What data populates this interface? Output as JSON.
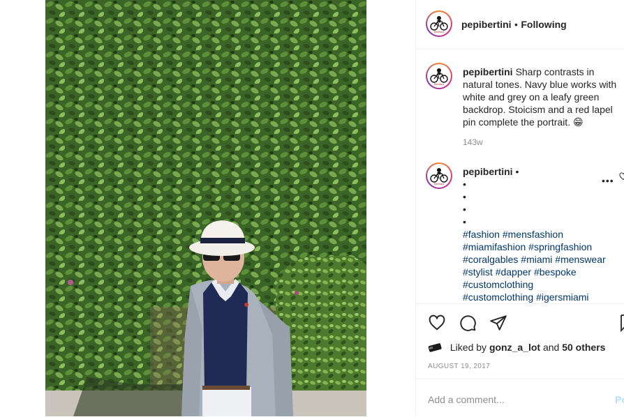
{
  "post": {
    "username": "pepibertini",
    "separator": "•",
    "follow_status": "Following"
  },
  "caption": {
    "username": "pepibertini",
    "text": "Sharp contrasts in natural tones. Navy blue works with white and grey on a leafy green backdrop. Stoicism and a red lapel pin complete the portrait. 😁",
    "time": "143w"
  },
  "comment": {
    "username": "pepibertini",
    "separator": "•",
    "bullets": [
      "•",
      "•",
      "•",
      "•"
    ],
    "hashtag_lines": [
      [
        "#fashion",
        "#mensfashion"
      ],
      [
        "#miamifashion",
        "#springfashion"
      ],
      [
        "#coralgables",
        "#miami",
        "#menswear"
      ],
      [
        "#stylist",
        "#dapper",
        "#bespoke"
      ],
      [
        "#customclothing"
      ],
      [
        "#customclothing",
        "#igersmiami"
      ]
    ],
    "more_label": "•••"
  },
  "likes": {
    "prefix": "Liked by",
    "user": "gonz_a_lot",
    "conj": "and",
    "others": "50 others"
  },
  "date": "AUGUST 19, 2017",
  "add_comment": {
    "placeholder": "Add a comment...",
    "post_label": "Po"
  },
  "icons": {
    "like": "heart-icon",
    "comment": "speech-bubble-icon",
    "share": "paper-plane-icon",
    "save": "bookmark-icon"
  },
  "colors": {
    "hashtag": "#00376b",
    "muted": "#8e8e8e",
    "post_button": "#b2dffc"
  }
}
